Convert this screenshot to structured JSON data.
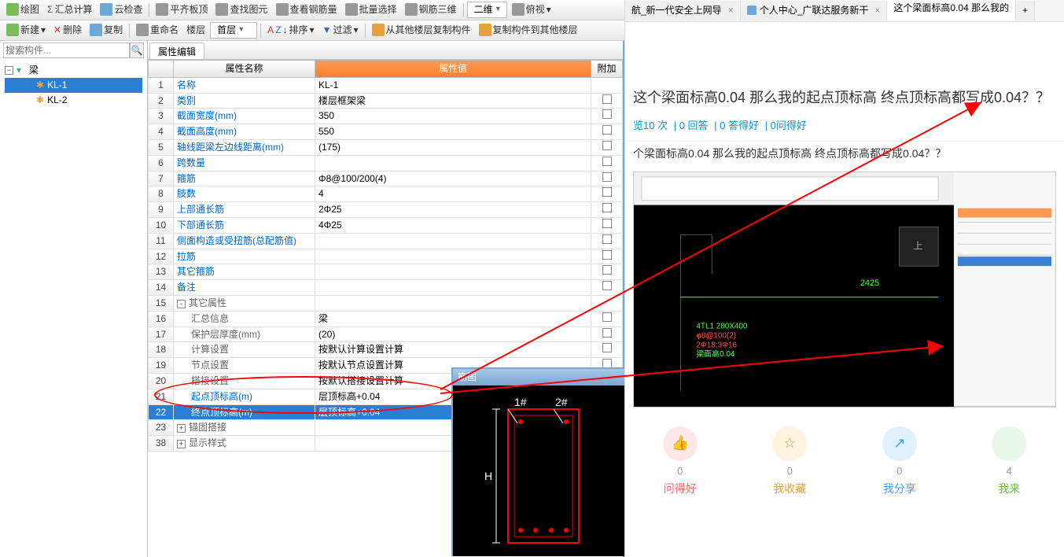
{
  "toolbar1": {
    "draw": "绘图",
    "sum": "汇总计算",
    "cloud": "云检查",
    "align": "平齐板顶",
    "find": "查找图元",
    "rebar": "查看钢筋量",
    "batch": "批量选择",
    "rebar3d": "钢筋三维",
    "dim": "二维",
    "view": "俯视"
  },
  "toolbar2": {
    "new": "新建",
    "del": "删除",
    "copy": "复制",
    "rename": "重命名",
    "floor": "楼层",
    "cfloor": "首层",
    "sort": "排序",
    "filter": "过滤",
    "copyfrom": "从其他楼层复制构件",
    "copyto": "复制构件到其他楼层"
  },
  "search_ph": "搜索构件...",
  "tree": {
    "root": "梁",
    "kl1": "KL-1",
    "kl2": "KL-2"
  },
  "tab": "属性编辑",
  "headers": {
    "name": "属性名称",
    "value": "属性值",
    "add": "附加"
  },
  "rows": [
    {
      "n": 1,
      "name": "名称",
      "val": "KL-1",
      "link": true
    },
    {
      "n": 2,
      "name": "类别",
      "val": "楼层框架梁",
      "link": true
    },
    {
      "n": 3,
      "name": "截面宽度(mm)",
      "val": "350",
      "link": true
    },
    {
      "n": 4,
      "name": "截面高度(mm)",
      "val": "550",
      "link": true
    },
    {
      "n": 5,
      "name": "轴线距梁左边线距离(mm)",
      "val": "(175)",
      "link": true
    },
    {
      "n": 6,
      "name": "跨数量",
      "val": "",
      "link": true
    },
    {
      "n": 7,
      "name": "箍筋",
      "val": "Φ8@100/200(4)",
      "link": true
    },
    {
      "n": 8,
      "name": "肢数",
      "val": "4",
      "link": true
    },
    {
      "n": 9,
      "name": "上部通长筋",
      "val": "2Φ25",
      "link": true
    },
    {
      "n": 10,
      "name": "下部通长筋",
      "val": "4Φ25",
      "link": true
    },
    {
      "n": 11,
      "name": "侧面构造或受扭筋(总配筋值)",
      "val": "",
      "link": true
    },
    {
      "n": 12,
      "name": "拉筋",
      "val": "",
      "link": true
    },
    {
      "n": 13,
      "name": "其它箍筋",
      "val": "",
      "link": true
    },
    {
      "n": 14,
      "name": "备注",
      "val": "",
      "link": true
    },
    {
      "n": 15,
      "name": "其它属性",
      "val": "",
      "group": true,
      "exp": "-"
    },
    {
      "n": 16,
      "name": "汇总信息",
      "val": "梁",
      "indent": true
    },
    {
      "n": 17,
      "name": "保护层厚度(mm)",
      "val": "(20)",
      "indent": true
    },
    {
      "n": 18,
      "name": "计算设置",
      "val": "按默认计算设置计算",
      "indent": true
    },
    {
      "n": 19,
      "name": "节点设置",
      "val": "按默认节点设置计算",
      "indent": true
    },
    {
      "n": 20,
      "name": "搭接设置",
      "val": "按默认搭接设置计算",
      "indent": true
    },
    {
      "n": 21,
      "name": "起点顶标高(m)",
      "val": "层顶标高+0.04",
      "indent": true,
      "link": true
    },
    {
      "n": 22,
      "name": "终点顶标高(m)",
      "val": "层顶标高+0.04",
      "indent": true,
      "link": true,
      "sel": true
    },
    {
      "n": 23,
      "name": "锚固搭接",
      "val": "",
      "group": true,
      "exp": "+"
    },
    {
      "n": 38,
      "name": "显示样式",
      "val": "",
      "group": true,
      "exp": "+"
    }
  ],
  "diagram": {
    "title": "筋图",
    "lbl1": "1#",
    "lbl2": "2#",
    "H": "H"
  },
  "browser": {
    "tab1": "航_新一代安全上网导",
    "tab2": "个人中心_广联达服务新干",
    "tab3": "这个梁面标高0.04 那么我的",
    "question": "这个梁面标高0.04 那么我的起点顶标高 终点顶标高都写成0.04？？",
    "stats": {
      "views": "览10 次",
      "ans": "0 回答",
      "good": "0 答得好",
      "qgood": "0问得好"
    },
    "subq": "个梁面标高0.04 那么我的起点顶标高 终点顶标高都写成0.04？？",
    "embed": {
      "dim": "2425",
      "beam": "4TL1 280X400",
      "r1": "φ8@100(2)",
      "r2": "2Φ18;3Φ16",
      "r3": "梁面高0.04"
    }
  },
  "actions": {
    "like": {
      "n": "0",
      "l": "问得好"
    },
    "fav": {
      "n": "0",
      "l": "我收藏"
    },
    "share": {
      "n": "0",
      "l": "我分享"
    },
    "ans": {
      "n": "4",
      "l": "我来"
    }
  }
}
